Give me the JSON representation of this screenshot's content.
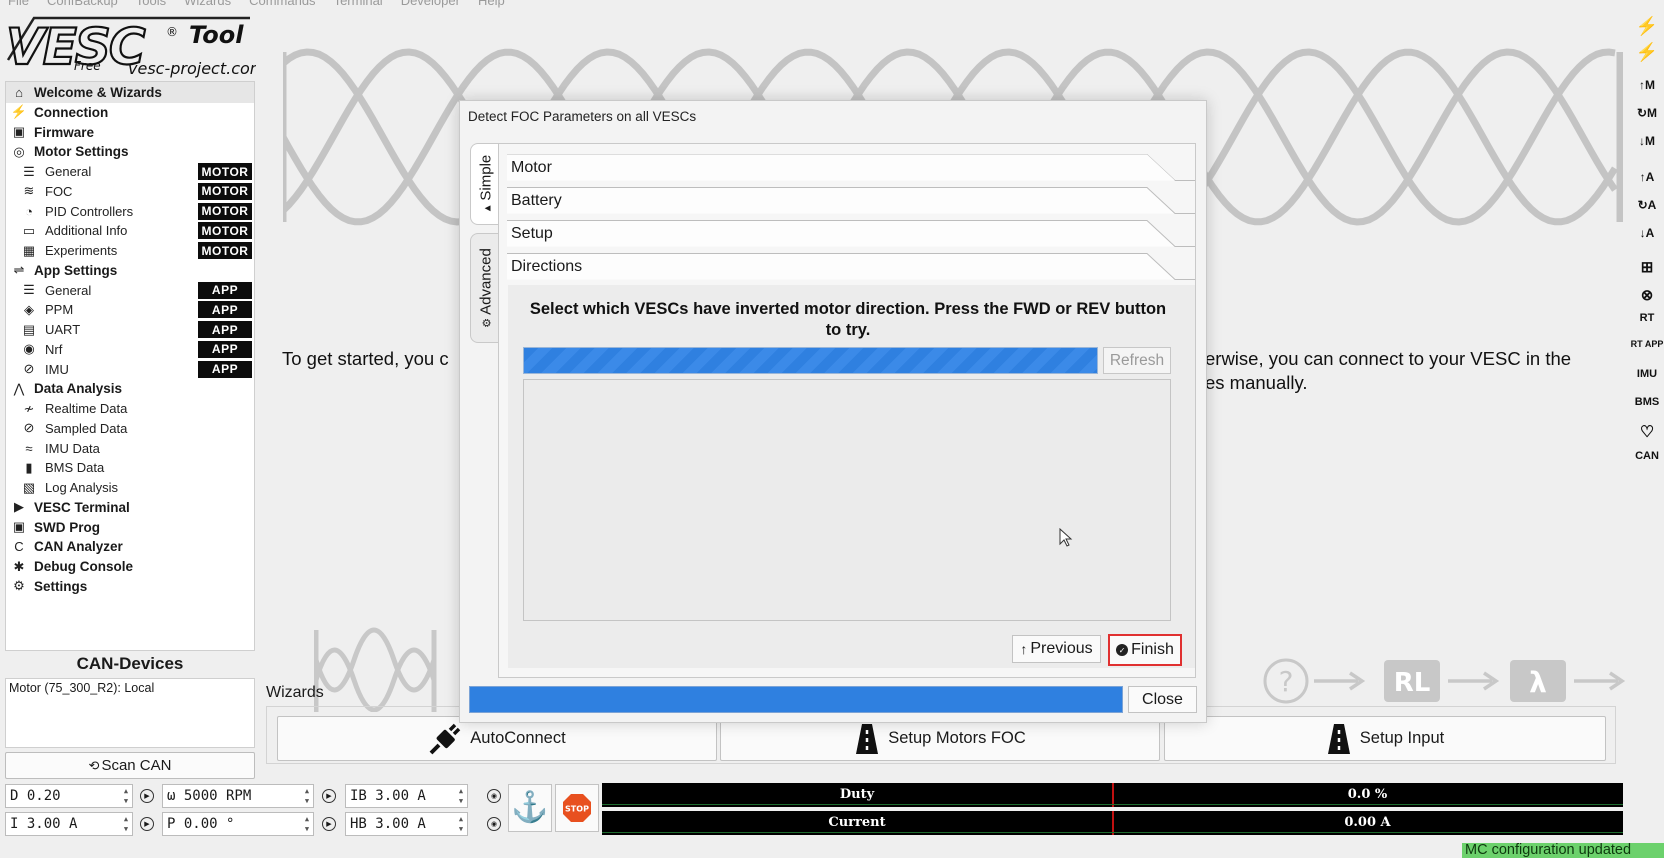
{
  "menubar": [
    "File",
    "ConfBackup",
    "Tools",
    "Wizards",
    "Commands",
    "Terminal",
    "Developer",
    "Help"
  ],
  "logo": {
    "main": "VESC",
    "sub": "Tool",
    "free": "Free",
    "site": "vesc-project.com"
  },
  "nav": {
    "items": [
      {
        "label": "Welcome & Wizards",
        "icon": "home-icon",
        "badge": ""
      },
      {
        "label": "Connection",
        "icon": "plug-icon",
        "badge": ""
      },
      {
        "label": "Firmware",
        "icon": "chip-icon",
        "badge": ""
      },
      {
        "label": "Motor Settings",
        "icon": "motor-icon",
        "badge": ""
      },
      {
        "label": "General",
        "icon": "sliders-icon",
        "badge": "MOTOR"
      },
      {
        "label": "FOC",
        "icon": "foc-icon",
        "badge": "MOTOR"
      },
      {
        "label": "PID Controllers",
        "icon": "gauge-icon",
        "badge": "MOTOR"
      },
      {
        "label": "Additional Info",
        "icon": "comment-icon",
        "badge": "MOTOR"
      },
      {
        "label": "Experiments",
        "icon": "calculator-icon",
        "badge": "MOTOR"
      },
      {
        "label": "App Settings",
        "icon": "app-settings-icon",
        "badge": ""
      },
      {
        "label": "General",
        "icon": "sliders-icon",
        "badge": "APP"
      },
      {
        "label": "PPM",
        "icon": "gamepad-icon",
        "badge": "APP"
      },
      {
        "label": "UART",
        "icon": "keyboard-icon",
        "badge": "APP"
      },
      {
        "label": "Nrf",
        "icon": "wireless-icon",
        "badge": "APP"
      },
      {
        "label": "IMU",
        "icon": "imu-icon",
        "badge": "APP"
      },
      {
        "label": "Data Analysis",
        "icon": "chart-icon",
        "badge": ""
      },
      {
        "label": "Realtime Data",
        "icon": "realtime-icon",
        "badge": ""
      },
      {
        "label": "Sampled Data",
        "icon": "sampled-icon",
        "badge": ""
      },
      {
        "label": "IMU Data",
        "icon": "imu-data-icon",
        "badge": ""
      },
      {
        "label": "BMS Data",
        "icon": "battery-icon",
        "badge": ""
      },
      {
        "label": "Log Analysis",
        "icon": "log-icon",
        "badge": ""
      },
      {
        "label": "VESC Terminal",
        "icon": "terminal-icon",
        "badge": ""
      },
      {
        "label": "SWD Prog",
        "icon": "chip-icon",
        "badge": ""
      },
      {
        "label": "CAN Analyzer",
        "icon": "can-icon",
        "badge": ""
      },
      {
        "label": "Debug Console",
        "icon": "bug-icon",
        "badge": ""
      },
      {
        "label": "Settings",
        "icon": "gear-icon",
        "badge": ""
      }
    ]
  },
  "can": {
    "title": "CAN-Devices",
    "device": "Motor (75_300_R2): Local",
    "scan_label": "Scan CAN",
    "scan_icon": "refresh-icon"
  },
  "welcome": {
    "intro_left": "To get started, you c",
    "intro_right_1": "erwise, you can connect to your VESC in the",
    "intro_right_2": "es manually.",
    "flow": [
      "?",
      "RL",
      "λ"
    ]
  },
  "wizards": {
    "label": "Wizards",
    "autoconnect": "AutoConnect",
    "setup_motors": "Setup Motors FOC",
    "setup_input": "Setup Input"
  },
  "dialog": {
    "title": "Detect FOC Parameters on all VESCs",
    "tabs": {
      "simple": "Simple",
      "advanced": "Advanced"
    },
    "sections": [
      "Motor",
      "Battery",
      "Setup",
      "Directions"
    ],
    "instruction": "Select which VESCs have inverted motor direction. Press the FWD or REV button to try.",
    "refresh": "Refresh",
    "previous": "Previous",
    "finish": "Finish",
    "close": "Close",
    "scan_progress": 1.0,
    "overall_progress": 1.0
  },
  "status": {
    "duty_input": "D 0.20",
    "current_input": "I 3.00 A",
    "rpm_input": "ω  5000 RPM",
    "pos_input": "P 0.00 °",
    "ib_input": "IB 3.00 A",
    "hb_input": "HB 3.00 A",
    "duty_label": "Duty",
    "duty_value": "0.0 %",
    "current_label": "Current",
    "current_value": "0.00 A",
    "stop_label": "STOP",
    "message": "MC configuration updated"
  },
  "right_toolbar": [
    "↑M",
    "↻M",
    "↓M",
    "↑A",
    "↻A",
    "↓A",
    "RT",
    "RT APP",
    "IMU",
    "BMS",
    "CAN"
  ],
  "colors": {
    "accent": "#2f80e0",
    "badge_bg": "#0c0c0c",
    "highlight": "#e03030",
    "status_ok": "#6cd16c",
    "stop": "#e8501f"
  }
}
